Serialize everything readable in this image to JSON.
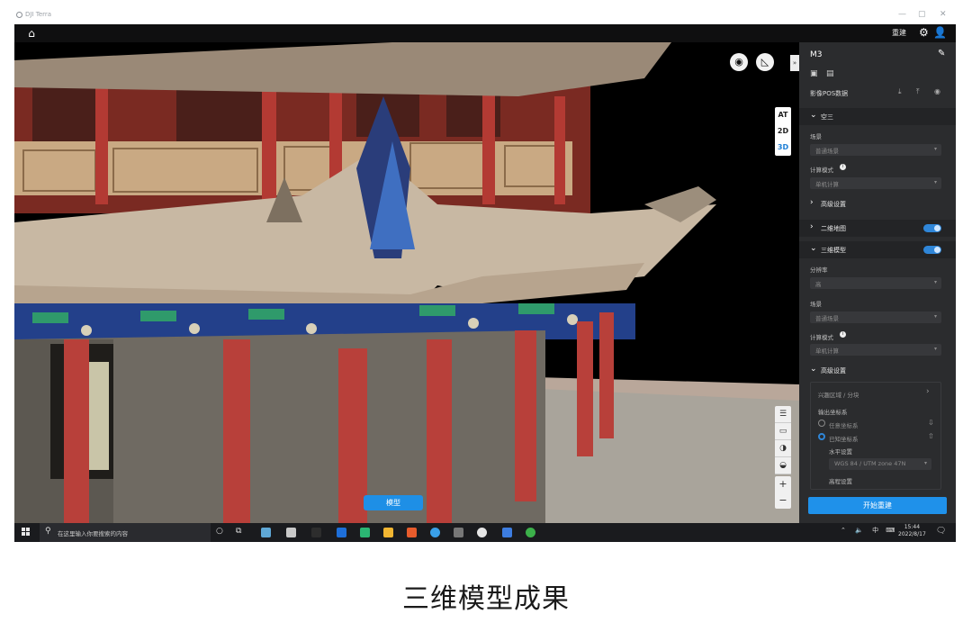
{
  "window": {
    "title": "DJI Terra",
    "controls": [
      "—",
      "▢",
      "✕"
    ]
  },
  "topbar": {
    "rebuild_label": "重建"
  },
  "viewport": {
    "modes": [
      "AT",
      "2D",
      "3D"
    ],
    "active_mode": "3D",
    "collapse_glyph": "»",
    "model_tag": "模型",
    "zoom_in": "+",
    "zoom_out": "−"
  },
  "panel": {
    "title": "M3",
    "pos_label": "影像POS数据",
    "aerotri": {
      "label": "空三",
      "scene_label": "场景",
      "scene_value": "普通场景",
      "compute_label": "计算模式",
      "compute_value": "单机计算",
      "advanced_label": "高级设置"
    },
    "map2d_label": "二维地图",
    "model3d": {
      "label": "三维模型",
      "resolution_label": "分辨率",
      "resolution_value": "高",
      "scene_label": "场景",
      "scene_value": "普通场景",
      "compute_label": "计算模式",
      "compute_value": "单机计算",
      "advanced_label": "高级设置",
      "roi_label": "兴趣区域 / 分块",
      "output_crs_label": "输出坐标系",
      "crs_option_1": "任意坐标系",
      "crs_option_2": "已知坐标系",
      "horizontal_label": "水平设置",
      "horizontal_value": "WGS 84 / UTM zone 47N",
      "elevation_label": "高程设置"
    },
    "start_button": "开始重建",
    "colors": {
      "accent": "#1f91ea",
      "panel_bg": "#2b2c2e"
    }
  },
  "taskbar": {
    "search_placeholder": "在这里输入你要搜索的内容",
    "ime": "中",
    "time": "15:44",
    "date": "2022/8/17"
  },
  "caption": "三维模型成果"
}
